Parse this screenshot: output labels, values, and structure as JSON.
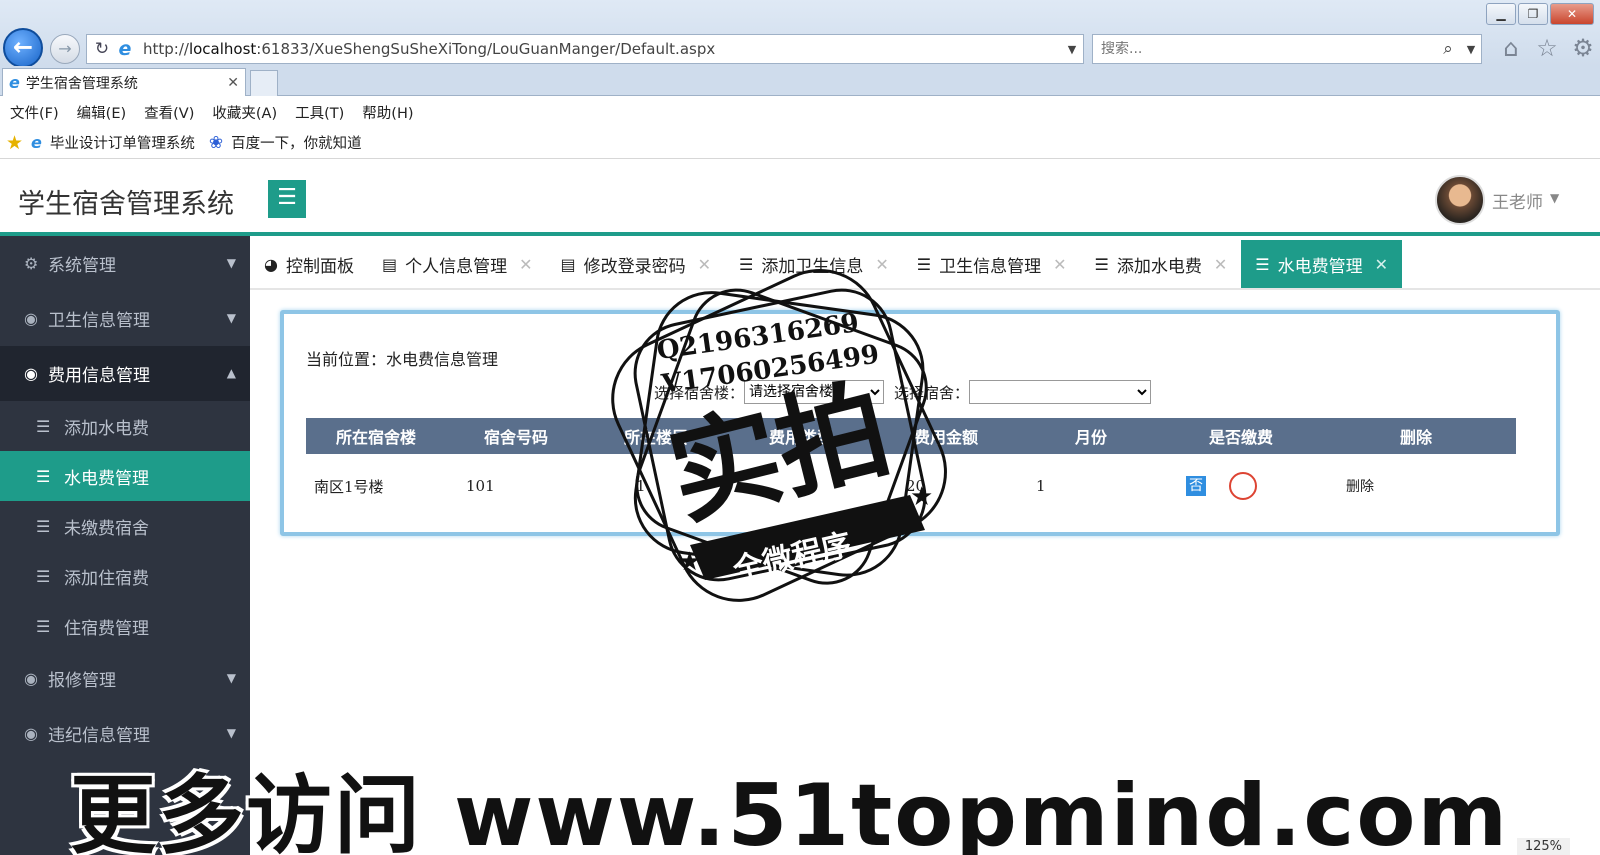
{
  "browser": {
    "url_prefix": "http://",
    "url_host": "localhost",
    "url_rest": ":61833/XueShengSuSheXiTong/LouGuanManger/Default.aspx",
    "search_placeholder": "搜索...",
    "tab_title": "学生宿舍管理系统",
    "menu": [
      "文件(F)",
      "编辑(E)",
      "查看(V)",
      "收藏夹(A)",
      "工具(T)",
      "帮助(H)"
    ],
    "favorites": [
      "毕业设计订单管理系统",
      "百度一下，你就知道"
    ],
    "zoom": "125%"
  },
  "app": {
    "title": "学生宿舍管理系统",
    "user": "王老师"
  },
  "sidebar": {
    "items": [
      {
        "label": "系统管理",
        "icon": "gears-icon",
        "open": false
      },
      {
        "label": "卫生信息管理",
        "icon": "circle-icon",
        "open": false
      },
      {
        "label": "费用信息管理",
        "icon": "circle-icon",
        "open": true,
        "children": [
          "添加水电费",
          "水电费管理",
          "未缴费宿舍",
          "添加住宿费",
          "住宿费管理"
        ],
        "active_child": "水电费管理"
      },
      {
        "label": "报修管理",
        "icon": "circle-icon",
        "open": false
      },
      {
        "label": "违纪信息管理",
        "icon": "circle-icon",
        "open": false
      }
    ]
  },
  "tabs": [
    {
      "label": "控制面板",
      "icon": "dashboard-icon",
      "closable": false
    },
    {
      "label": "个人信息管理",
      "icon": "document-icon",
      "closable": true
    },
    {
      "label": "修改登录密码",
      "icon": "document-icon",
      "closable": true
    },
    {
      "label": "添加卫生信息",
      "icon": "list-icon",
      "closable": true
    },
    {
      "label": "卫生信息管理",
      "icon": "list-icon",
      "closable": true
    },
    {
      "label": "添加水电费",
      "icon": "list-icon",
      "closable": true
    },
    {
      "label": "水电费管理",
      "icon": "list-icon",
      "closable": true,
      "active": true
    }
  ],
  "content": {
    "breadcrumb": "当前位置：水电费信息管理",
    "building_label": "选择宿舍楼：",
    "building_placeholder": "请选择宿舍楼",
    "room_label": "选择宿舍：",
    "room_value": "",
    "columns": [
      "所在宿舍楼",
      "宿舍号码",
      "所在楼层",
      "费用类型",
      "费用金额",
      "月份",
      "是否缴费",
      "删除"
    ],
    "rows": [
      {
        "building": "南区1号楼",
        "room": "101",
        "floor": "1",
        "fee_type": "",
        "amount": "20",
        "month": "1",
        "paid": "否",
        "delete": "删除"
      }
    ]
  },
  "stamp": {
    "qq": "Q2196316269",
    "wechat": "V17060256499",
    "big": "实拍",
    "banner": "全微程序"
  },
  "watermark": "更多访问 www.51topmind.com"
}
